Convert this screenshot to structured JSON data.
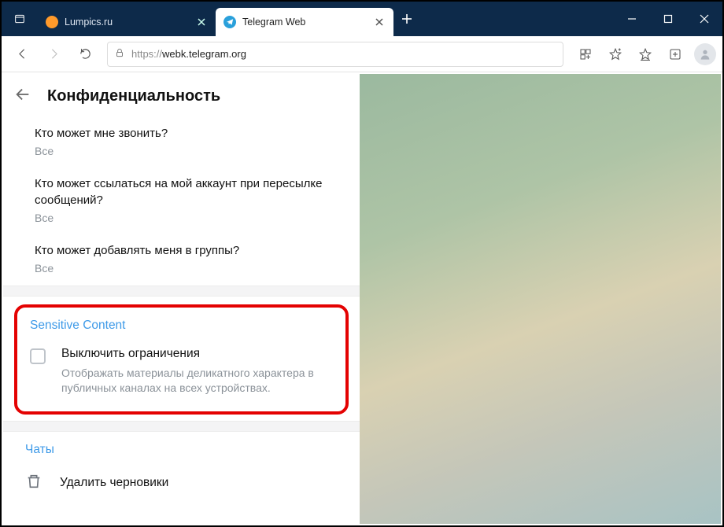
{
  "titlebar": {
    "tabs": [
      {
        "title": "Lumpics.ru",
        "active": false
      },
      {
        "title": "Telegram Web",
        "active": true
      }
    ]
  },
  "toolbar": {
    "url_scheme": "https://",
    "url_host": "webk.telegram.org"
  },
  "settings": {
    "page_title": "Конфиденциальность",
    "rows": [
      {
        "q": "Кто может мне звонить?",
        "a": "Все"
      },
      {
        "q": "Кто может ссылаться на мой аккаунт при пересылке сообщений?",
        "a": "Все"
      },
      {
        "q": "Кто может добавлять меня в группы?",
        "a": "Все"
      }
    ],
    "sensitive": {
      "section_title": "Sensitive Content",
      "toggle_label": "Выключить ограничения",
      "toggle_desc": "Отображать материалы деликатного характера в публичных каналах на всех устройствах."
    },
    "chats": {
      "section_title": "Чаты",
      "delete_drafts": "Удалить черновики"
    }
  }
}
